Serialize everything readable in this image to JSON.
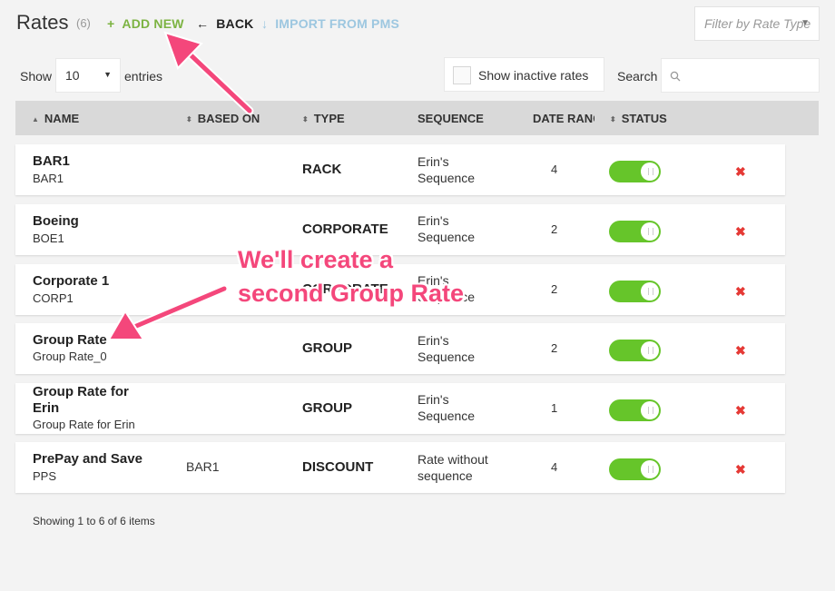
{
  "header": {
    "title": "Rates",
    "count": "(6)",
    "add_new": "ADD NEW",
    "back": "BACK",
    "import": "IMPORT FROM PMS",
    "filter_placeholder": "Filter by Rate Type"
  },
  "controls": {
    "show_label": "Show",
    "show_value": "10",
    "entries_label": "entries",
    "inactive_label": "Show inactive rates",
    "search_label": "Search"
  },
  "table": {
    "columns": [
      "NAME",
      "BASED ON",
      "TYPE",
      "SEQUENCE",
      "DATE RANGE",
      "STATUS"
    ],
    "rows": [
      {
        "name": "BAR1",
        "code": "BAR1",
        "based_on": "",
        "type": "RACK",
        "sequence": [
          "Erin's",
          "Sequence"
        ],
        "date_ranges": "4",
        "active": true
      },
      {
        "name": "Boeing",
        "code": "BOE1",
        "based_on": "",
        "type": "CORPORATE",
        "sequence": [
          "Erin's",
          "Sequence"
        ],
        "date_ranges": "2",
        "active": true
      },
      {
        "name": "Corporate 1",
        "code": "CORP1",
        "based_on": "",
        "type": "CORPORATE",
        "sequence": [
          "Erin's",
          "Sequence"
        ],
        "date_ranges": "2",
        "active": true
      },
      {
        "name": "Group Rate",
        "code": "Group Rate_0",
        "based_on": "",
        "type": "GROUP",
        "sequence": [
          "Erin's",
          "Sequence"
        ],
        "date_ranges": "2",
        "active": true
      },
      {
        "name_lines": [
          "Group Rate for",
          "Erin"
        ],
        "code": "Group Rate for Erin",
        "based_on": "",
        "type": "GROUP",
        "sequence": [
          "Erin's",
          "Sequence"
        ],
        "date_ranges": "1",
        "active": true
      },
      {
        "name": "PrePay and Save",
        "code": "PPS",
        "based_on": "BAR1",
        "type": "DISCOUNT",
        "sequence": [
          "Rate without",
          "sequence"
        ],
        "date_ranges": "4",
        "active": true
      }
    ]
  },
  "footer": {
    "info": "Showing 1 to 6 of 6 items"
  },
  "annotation": {
    "lines": [
      "We'll create a",
      "second Group Rate"
    ]
  },
  "icons": {
    "add": "plus-icon",
    "back": "arrow-left-icon",
    "import": "arrow-down-icon",
    "search": "search-icon",
    "delete": "close-icon",
    "sort": "sort-icon"
  },
  "colors": {
    "accent_green": "#7cb342",
    "toggle_on": "#66c52a",
    "delete_red": "#e53935",
    "annotation_pink": "#f4477b",
    "import_blue": "#9dc7e0"
  }
}
